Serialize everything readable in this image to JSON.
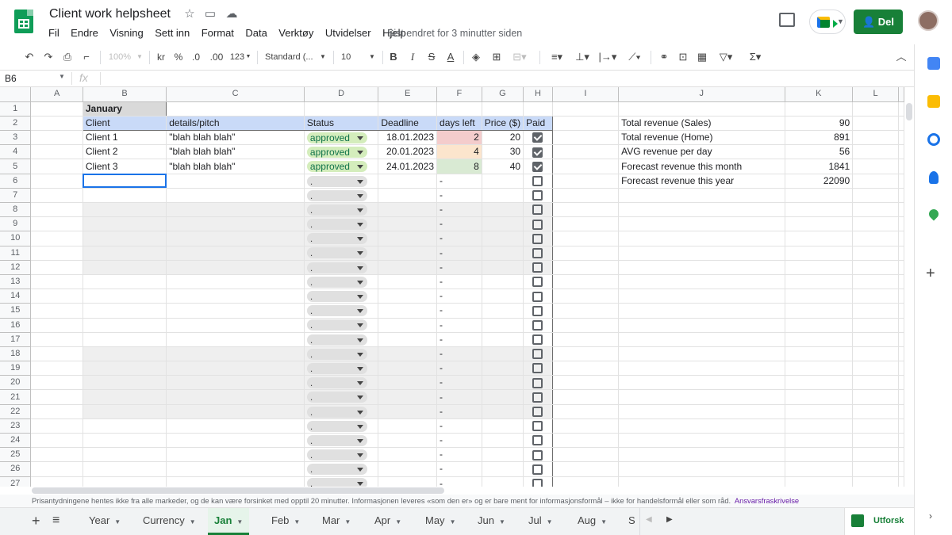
{
  "header": {
    "title": "Client work helpsheet",
    "menu": [
      "Fil",
      "Endre",
      "Visning",
      "Sett inn",
      "Format",
      "Data",
      "Verktøy",
      "Utvidelser",
      "Hjelp"
    ],
    "last_edit": "Sist endret for 3 minutter siden",
    "share_label": "Del"
  },
  "toolbar": {
    "zoom": "100%",
    "currency": "kr",
    "percent": "%",
    "dec_less": ".0",
    "dec_more": ".00",
    "numfmt": "123",
    "font": "Standard (...",
    "size": "10"
  },
  "formula_bar": {
    "namebox": "B6",
    "fx": "fx",
    "value": ""
  },
  "columns": [
    "A",
    "B",
    "C",
    "D",
    "E",
    "F",
    "G",
    "H",
    "I",
    "J",
    "K",
    "L"
  ],
  "grid": {
    "month": "January",
    "headers": [
      "Client",
      "details/pitch",
      "Status",
      "Deadline",
      "days left",
      "Price ($)",
      "Paid"
    ],
    "rows": [
      {
        "client": "Client 1",
        "details": "\"blah blah blah\"",
        "status": "approved",
        "deadline": "18.01.2023",
        "days": "2",
        "price": "20",
        "paid": true
      },
      {
        "client": "Client 2",
        "details": "\"blah blah blah\"",
        "status": "approved",
        "deadline": "20.01.2023",
        "days": "4",
        "price": "30",
        "paid": true
      },
      {
        "client": "Client 3",
        "details": "\"blah blah blah\"",
        "status": "approved",
        "deadline": "24.01.2023",
        "days": "8",
        "price": "40",
        "paid": true
      }
    ],
    "empty_status": ".",
    "empty_days": "-",
    "summary": [
      {
        "label": "Total revenue (Sales)",
        "value": "90"
      },
      {
        "label": "Total revenue (Home)",
        "value": "891"
      },
      {
        "label": "AVG revenue per day",
        "value": "56"
      },
      {
        "label": "Forecast revenue this month",
        "value": "1841"
      },
      {
        "label": "Forecast revenue this year",
        "value": "22090"
      }
    ]
  },
  "disclaimer": {
    "text": "Prisantydningene hentes ikke fra alle markeder, og de kan være forsinket med opptil 20 minutter. Informasjonen leveres «som den er» og er bare ment for informasjonsformål – ikke for handelsformål eller som råd.",
    "link": "Ansvarsfraskrivelse"
  },
  "tabs": [
    "Year",
    "Currency",
    "Jan",
    "Feb",
    "Mar",
    "Apr",
    "May",
    "Jun",
    "Jul",
    "Aug",
    "S"
  ],
  "active_tab": "Jan",
  "explore_label": "Utforsk",
  "colors": {
    "green": "#188038",
    "header_blue": "#c9daf8",
    "chip_green": "#d4edbc",
    "red": "#f4cccc",
    "orange": "#fce5cd",
    "light_green": "#d9ead3"
  }
}
